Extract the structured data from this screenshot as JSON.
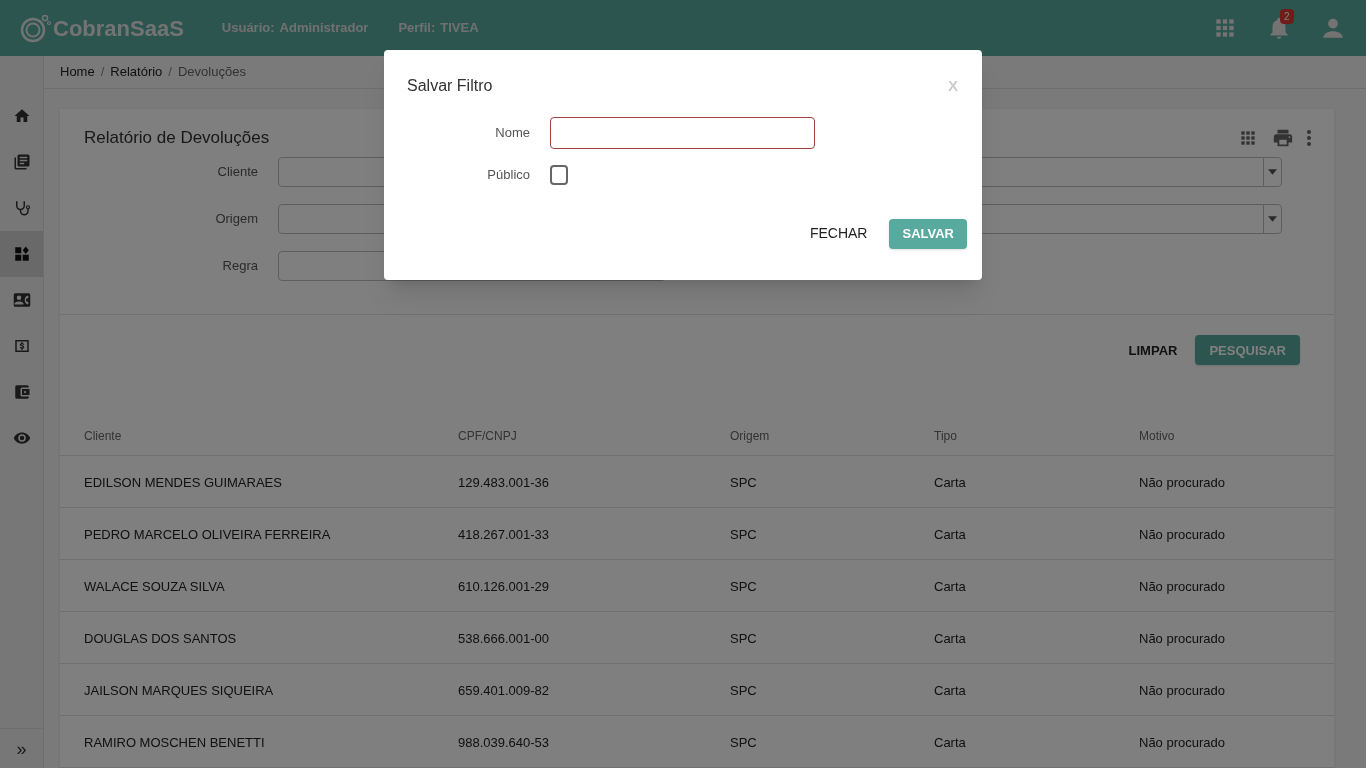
{
  "header": {
    "logo": "CobranSaaS",
    "user_label": "Usuário:",
    "user": "Administrador",
    "profile_label": "Perfil:",
    "profile": "TIVEA",
    "notifications": "2"
  },
  "sidebar": {
    "items": [
      {
        "selected": false
      },
      {
        "selected": false
      },
      {
        "selected": false
      },
      {
        "selected": true
      },
      {
        "selected": false
      },
      {
        "selected": false
      },
      {
        "selected": false
      },
      {
        "selected": false
      }
    ],
    "expand": "»"
  },
  "breadcrumb": {
    "separator": "/",
    "items": [
      "Home",
      "Relatório",
      "Devoluções"
    ]
  },
  "card": {
    "title": "Relatório de Devoluções",
    "filters": [
      {
        "label": "Cliente"
      },
      {
        "label": "Origem"
      },
      {
        "label": "Regra"
      }
    ],
    "buttons": {
      "clear": "LIMPAR",
      "search": "PESQUISAR"
    },
    "table": {
      "columns": [
        "Cliente",
        "CPF/CNPJ",
        "Origem",
        "Tipo",
        "Motivo"
      ],
      "rows": [
        [
          "EDILSON MENDES GUIMARAES",
          "129.483.001-36",
          "SPC",
          "Carta",
          "Não procurado"
        ],
        [
          "PEDRO MARCELO OLIVEIRA FERREIRA",
          "418.267.001-33",
          "SPC",
          "Carta",
          "Não procurado"
        ],
        [
          "WALACE SOUZA SILVA",
          "610.126.001-29",
          "SPC",
          "Carta",
          "Não procurado"
        ],
        [
          "DOUGLAS DOS SANTOS",
          "538.666.001-00",
          "SPC",
          "Carta",
          "Não procurado"
        ],
        [
          "JAILSON MARQUES SIQUEIRA",
          "659.401.009-82",
          "SPC",
          "Carta",
          "Não procurado"
        ],
        [
          "RAMIRO MOSCHEN BENETTI",
          "988.039.640-53",
          "SPC",
          "Carta",
          "Não procurado"
        ]
      ]
    }
  },
  "modal": {
    "title": "Salvar Filtro",
    "close": "X",
    "name_label": "Nome",
    "public_label": "Público",
    "public_checked": false,
    "cancel": "FECHAR",
    "save": "SALVAR"
  }
}
